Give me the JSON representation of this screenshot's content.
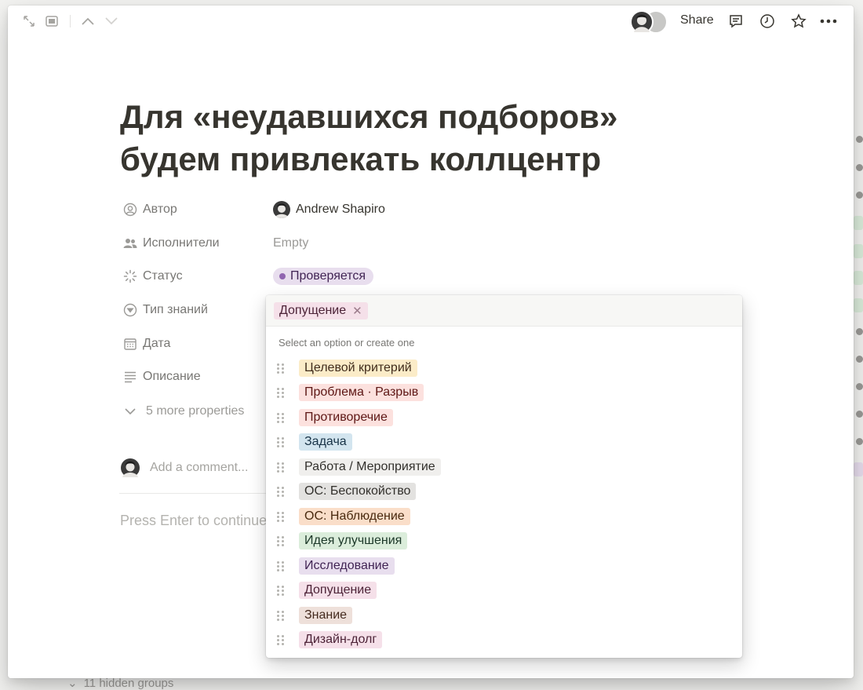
{
  "window": {
    "share_label": "Share"
  },
  "icons": {
    "expand": "expand-icon",
    "peek": "peek-mode-icon",
    "up": "chevron-up-icon",
    "down": "chevron-down-icon",
    "comments": "comment-icon",
    "history": "clock-icon",
    "favorite": "star-icon",
    "more": "more-horizontal-icon"
  },
  "page": {
    "title": "Для «неудавшихся подборов» будем привлекать коллцентр",
    "properties": [
      {
        "label": "Автор",
        "icon": "person-circle-icon"
      },
      {
        "label": "Исполнители",
        "icon": "people-icon"
      },
      {
        "label": "Статус",
        "icon": "status-spinner-icon"
      },
      {
        "label": "Тип знаний",
        "icon": "select-icon"
      },
      {
        "label": "Дата",
        "icon": "calendar-icon"
      },
      {
        "label": "Описание",
        "icon": "text-lines-icon"
      }
    ],
    "author_value": "Andrew Shapiro",
    "assignees_value": "Empty",
    "status_value": "Проверяется",
    "more_properties": "5 more properties",
    "comment_placeholder": "Add a comment...",
    "press_enter": "Press Enter to continue"
  },
  "dropdown": {
    "selected_chip": "Допущение",
    "hint": "Select an option or create one",
    "options": [
      {
        "label": "Целевой критерий",
        "bg": "#fbecc8",
        "fg": "#402c1b"
      },
      {
        "label": "Проблема · Разрыв",
        "bg": "#fce1de",
        "fg": "#5d1715"
      },
      {
        "label": "Противоречие",
        "bg": "#fce1de",
        "fg": "#5d1715"
      },
      {
        "label": "Задача",
        "bg": "#d3e5ef",
        "fg": "#183347"
      },
      {
        "label": "Работа / Мероприятие",
        "bg": "#f0efed",
        "fg": "#32302c"
      },
      {
        "label": "ОС: Беспокойство",
        "bg": "#e3e2e0",
        "fg": "#32302c"
      },
      {
        "label": "ОС: Наблюдение",
        "bg": "#fadec9",
        "fg": "#49290e"
      },
      {
        "label": "Идея улучшения",
        "bg": "#dbeddb",
        "fg": "#1c3829"
      },
      {
        "label": "Исследование",
        "bg": "#e8deee",
        "fg": "#412454"
      },
      {
        "label": "Допущение",
        "bg": "#f5e0e9",
        "fg": "#4c2337"
      },
      {
        "label": "Знание",
        "bg": "#eee0da",
        "fg": "#442a1e"
      },
      {
        "label": "Дизайн-долг",
        "bg": "#f5e0e9",
        "fg": "#4c2337"
      }
    ]
  },
  "background": {
    "hidden_groups": "11 hidden groups"
  }
}
